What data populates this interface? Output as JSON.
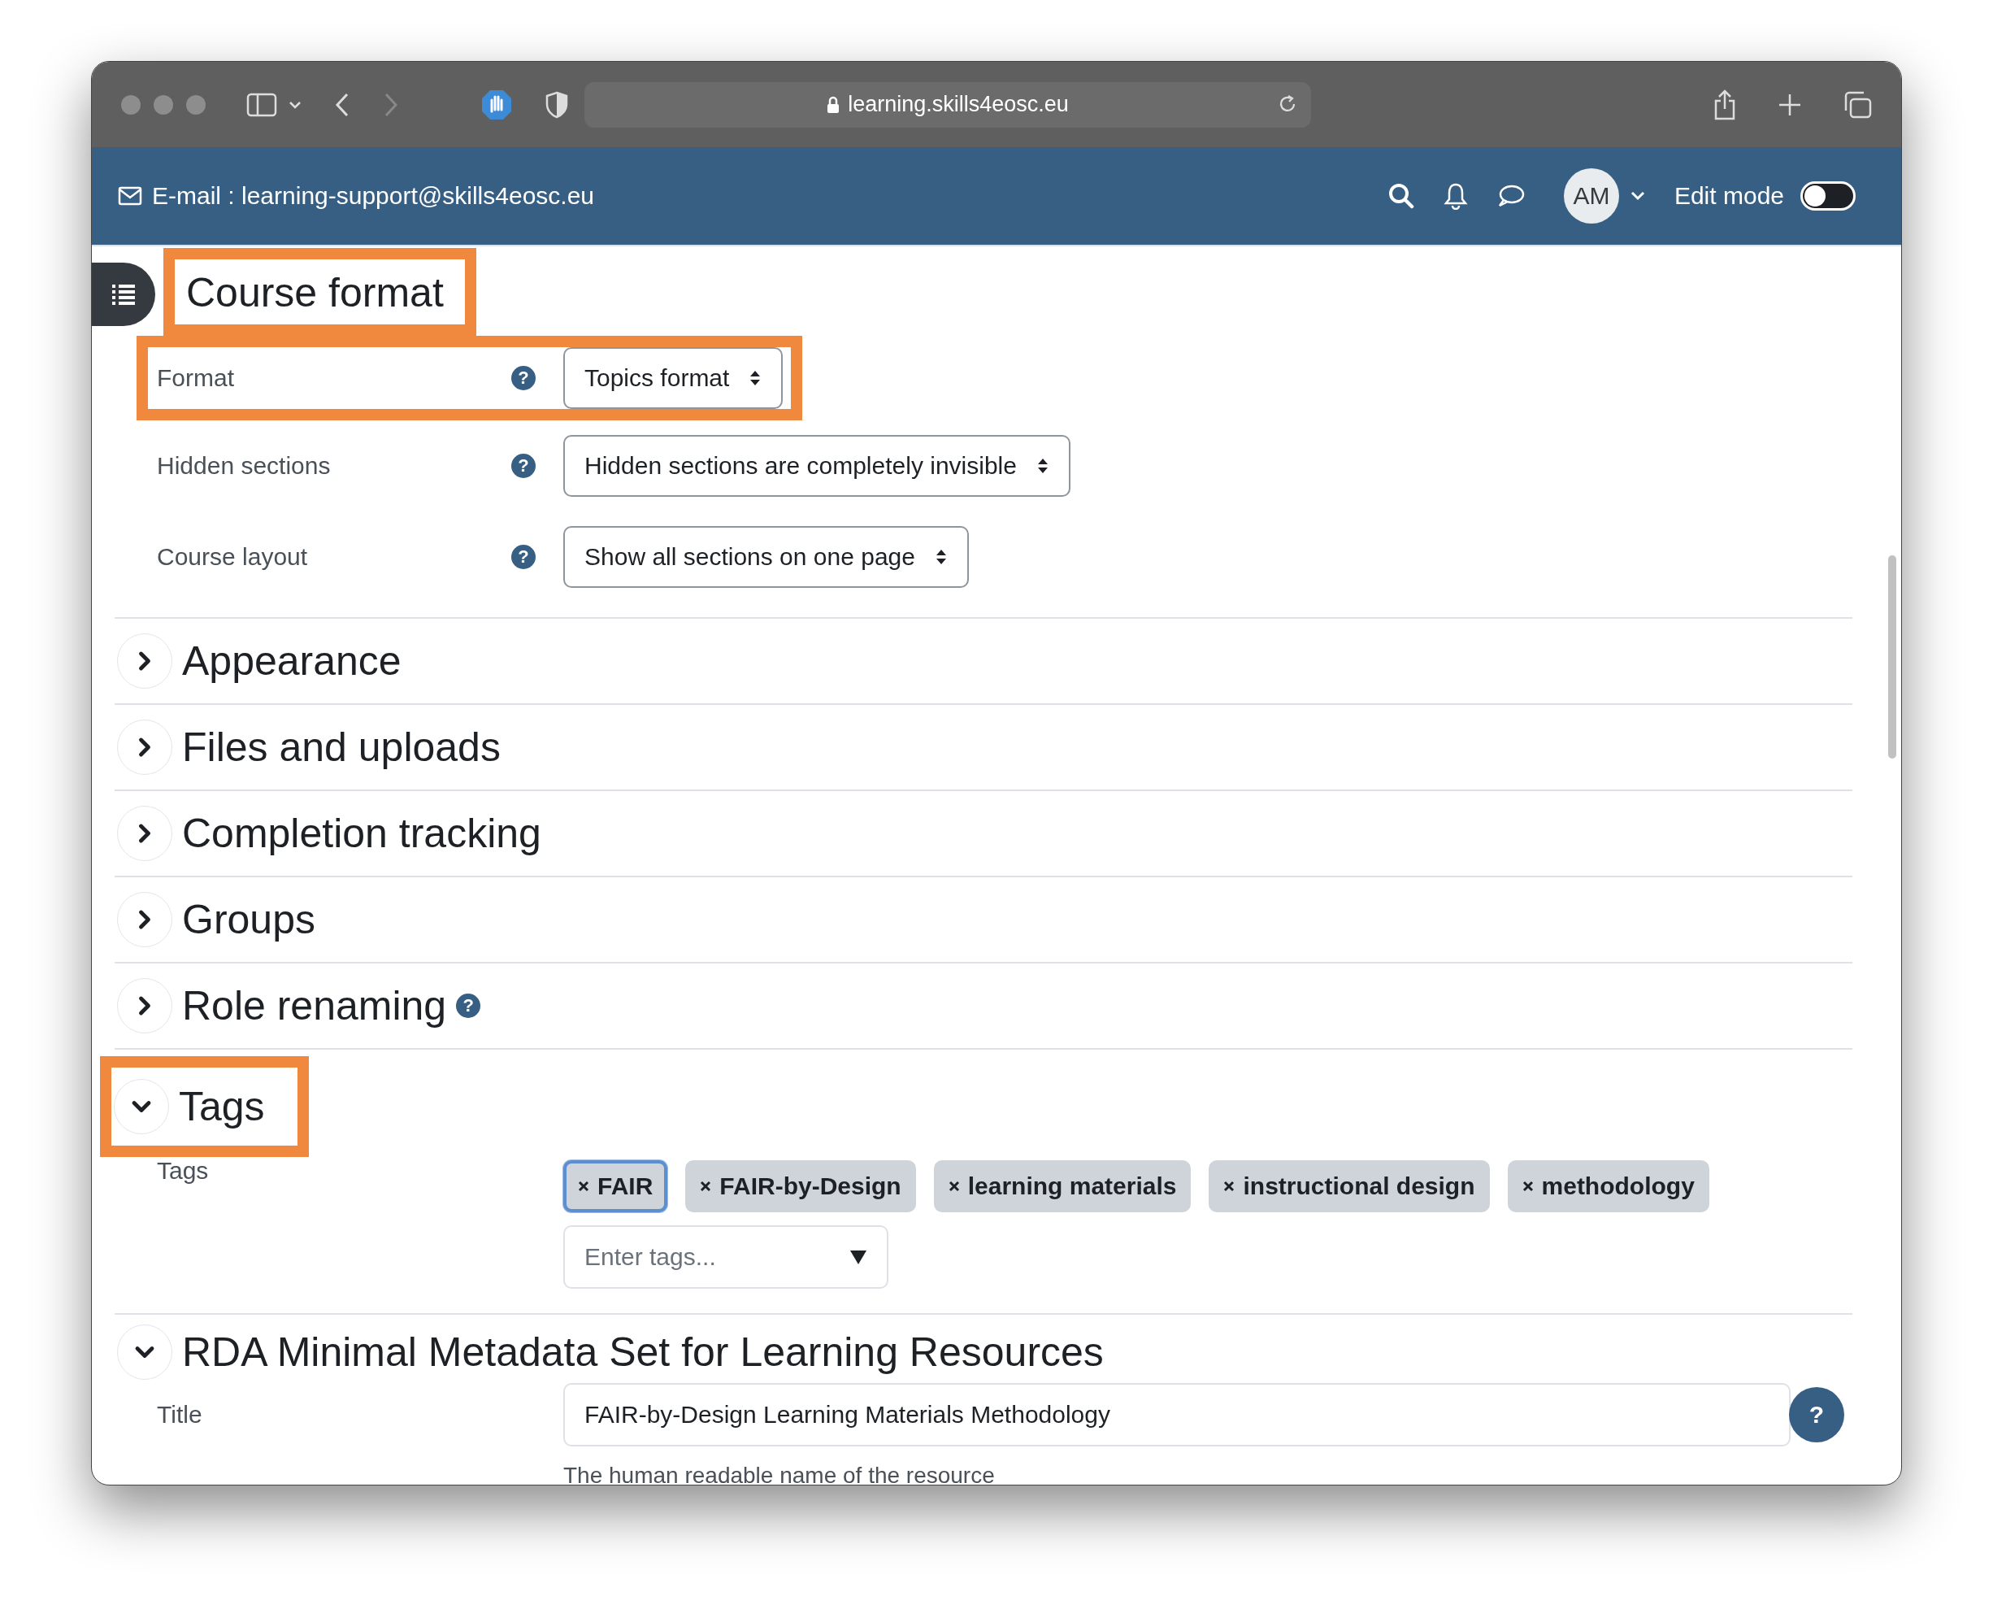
{
  "browser": {
    "url": "learning.skills4eosc.eu"
  },
  "header": {
    "email": "E-mail : learning-support@skills4eosc.eu",
    "avatar": "AM",
    "edit_mode": {
      "label": "Edit mode",
      "on": false
    }
  },
  "course_format": {
    "title": "Course format",
    "highlighted": true,
    "fields": [
      {
        "label": "Format",
        "help": "?",
        "value": "Topics format",
        "highlighted": true
      },
      {
        "label": "Hidden sections",
        "help": "?",
        "value": "Hidden sections are completely invisible",
        "highlighted": false
      },
      {
        "label": "Course layout",
        "help": "?",
        "value": "Show all sections on one page",
        "highlighted": false
      }
    ]
  },
  "sections": [
    {
      "title": "Appearance",
      "expanded": false
    },
    {
      "title": "Files and uploads",
      "expanded": false
    },
    {
      "title": "Completion tracking",
      "expanded": false
    },
    {
      "title": "Groups",
      "expanded": false
    },
    {
      "title": "Role renaming",
      "expanded": false,
      "help": "?"
    }
  ],
  "tags": {
    "title": "Tags",
    "expanded": true,
    "highlighted": true,
    "label": "Tags",
    "chips": [
      {
        "label": "FAIR",
        "selected": true
      },
      {
        "label": "FAIR-by-Design",
        "selected": false
      },
      {
        "label": "learning materials",
        "selected": false
      },
      {
        "label": "instructional design",
        "selected": false
      },
      {
        "label": "methodology",
        "selected": false
      }
    ],
    "placeholder": "Enter tags..."
  },
  "rda": {
    "title": "RDA Minimal Metadata Set for Learning Resources",
    "expanded": true,
    "fields": [
      {
        "label": "Title",
        "help": "?",
        "value": "FAIR-by-Design Learning Materials Methodology",
        "hint": "The human readable name of the resource"
      }
    ]
  }
}
